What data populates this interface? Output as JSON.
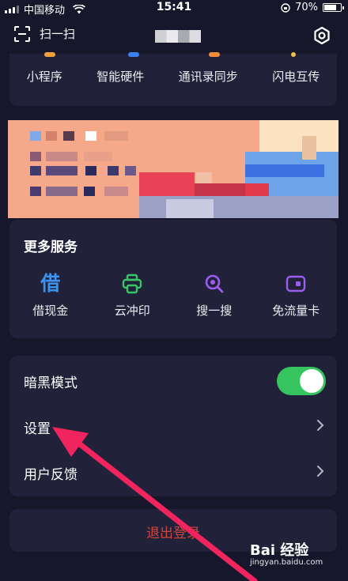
{
  "status_bar": {
    "carrier": "中国移动",
    "time": "15:41",
    "battery": "70%"
  },
  "header": {
    "scan_label": "扫一扫"
  },
  "shortcuts": [
    {
      "label": "小程序",
      "icon": "mini-program-icon",
      "color": "#f2a03d"
    },
    {
      "label": "智能硬件",
      "icon": "smart-hardware-icon",
      "color": "#3d7ff0"
    },
    {
      "label": "通讯录同步",
      "icon": "contacts-sync-icon",
      "color": "#f08c3d"
    },
    {
      "label": "闪电互传",
      "icon": "lightning-transfer-icon",
      "color": "#f0c23d"
    }
  ],
  "services": {
    "title": "更多服务",
    "items": [
      {
        "label": "借现金",
        "glyph": "借",
        "icon": "cash-loan-icon",
        "color": "#3d93f0"
      },
      {
        "label": "云冲印",
        "icon": "cloud-print-icon",
        "color": "#39c466"
      },
      {
        "label": "搜一搜",
        "icon": "search-icon",
        "color": "#9b5cf0"
      },
      {
        "label": "免流量卡",
        "icon": "data-card-icon",
        "color": "#9b5cf0"
      }
    ]
  },
  "settings": {
    "dark_mode_label": "暗黑模式",
    "dark_mode_on": true,
    "settings_label": "设置",
    "feedback_label": "用户反馈"
  },
  "logout": {
    "label": "退出登录"
  },
  "watermark": {
    "brand": "Bai 经验",
    "site": "jingyan.baidu.com"
  },
  "colors": {
    "background": "#16172b",
    "card": "#21223a",
    "toggle_on": "#35c45d",
    "logout_text": "#d2453d",
    "arrow": "#f0245e"
  }
}
